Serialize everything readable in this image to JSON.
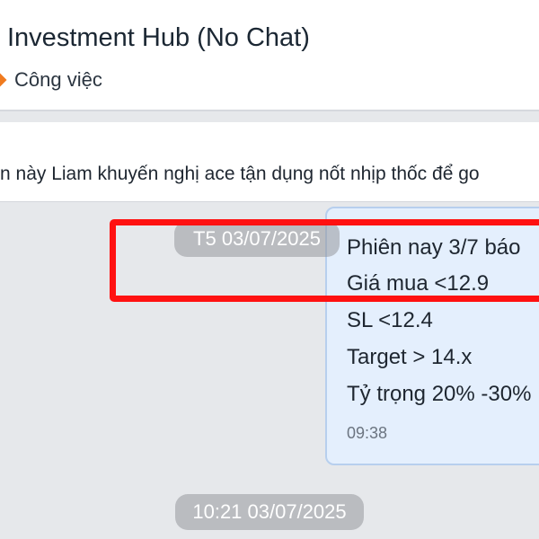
{
  "header": {
    "title": "Investment Hub (No Chat)",
    "category_icon": "diamond-icon",
    "category": "Công việc",
    "accent_color": "#f07b1f"
  },
  "pinned_message": {
    "text": "n này Liam khuyến nghị ace tận dụng nốt nhịp thốc để go"
  },
  "messages": [
    {
      "date_separator": "T5 03/07/2025",
      "lines": [
        "Phiên nay 3/7 báo",
        "Giá mua <12.9",
        "SL <12.4",
        "Target > 14.x",
        "Tỷ trọng 20% -30%"
      ],
      "time": "09:38"
    }
  ],
  "next_date_separator": "10:21 03/07/2025",
  "annotation": {
    "color": "#ff1111"
  }
}
